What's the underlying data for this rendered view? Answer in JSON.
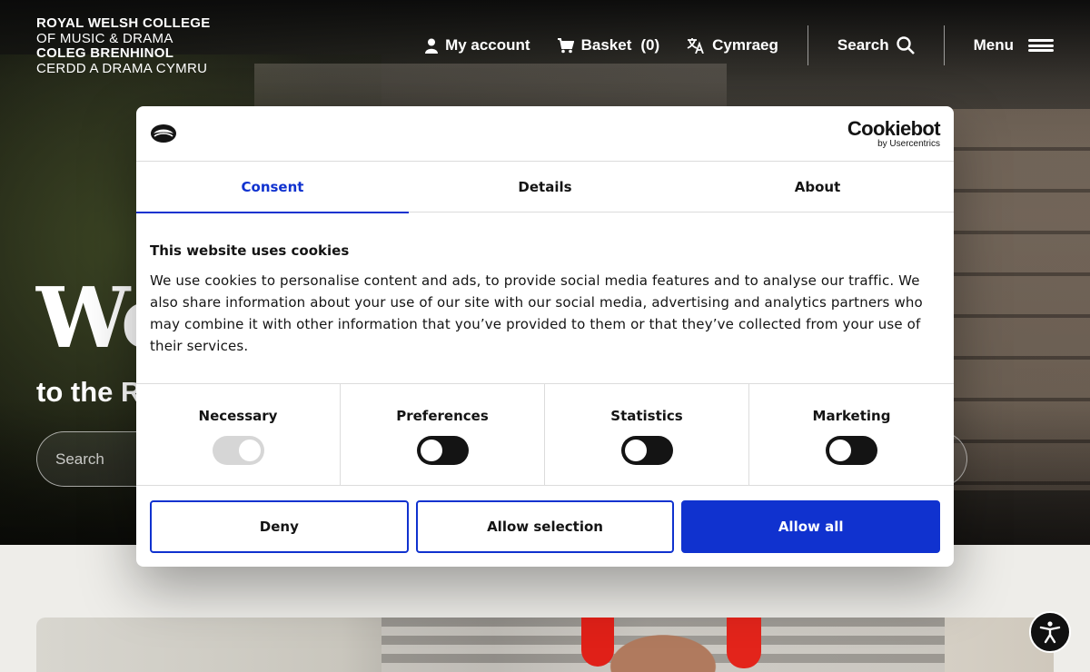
{
  "site": {
    "logo_lines": [
      "ROYAL WELSH COLLEGE",
      "OF MUSIC & DRAMA",
      "COLEG BRENHINOL",
      "CERDD A DRAMA CYMRU"
    ]
  },
  "nav": {
    "account": "My account",
    "basket": "Basket",
    "basket_count": "(0)",
    "language": "Cymraeg",
    "search": "Search",
    "menu": "Menu"
  },
  "hero": {
    "title": "We",
    "subtitle": "to the R",
    "search_placeholder": "Search"
  },
  "cookie": {
    "brand": "Cookiebot",
    "brand_sub": "by Usercentrics",
    "tabs": [
      "Consent",
      "Details",
      "About"
    ],
    "active_tab": "Consent",
    "heading": "This website uses cookies",
    "text": "We use cookies to personalise content and ads, to provide social media features and to analyse our traffic. We also share information about your use of our site with our social media, advertising and analytics partners who may combine it with other information that you’ve provided to them or that they’ve collected from your use of their services.",
    "categories": [
      {
        "label": "Necessary",
        "enabled": true,
        "locked": true
      },
      {
        "label": "Preferences",
        "enabled": false,
        "locked": false
      },
      {
        "label": "Statistics",
        "enabled": false,
        "locked": false
      },
      {
        "label": "Marketing",
        "enabled": false,
        "locked": false
      }
    ],
    "buttons": {
      "deny": "Deny",
      "allow_selection": "Allow selection",
      "allow_all": "Allow all"
    }
  },
  "colors": {
    "accent": "#1032cf",
    "dark": "#141414",
    "page_bg": "#eeede9"
  }
}
